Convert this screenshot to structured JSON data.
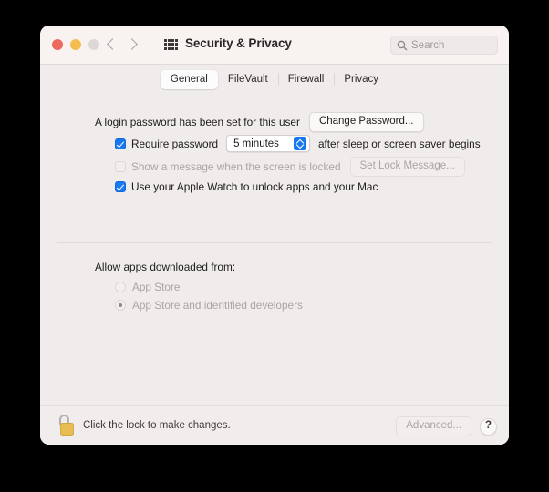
{
  "window": {
    "title": "Security & Privacy",
    "traffic_lights": [
      {
        "name": "close",
        "color": "#ec6a5e"
      },
      {
        "name": "minimize",
        "color": "#f4bd4f"
      },
      {
        "name": "zoom",
        "color": "#dcd8d8"
      }
    ],
    "nav": {
      "back_icon": "chevron-left-icon",
      "forward_icon": "chevron-right-icon"
    },
    "show_all_icon": "grid-icon",
    "search": {
      "placeholder": "Search",
      "value": "",
      "icon": "search-icon"
    }
  },
  "tabs": [
    {
      "label": "General",
      "selected": true
    },
    {
      "label": "FileVault",
      "selected": false
    },
    {
      "label": "Firewall",
      "selected": false
    },
    {
      "label": "Privacy",
      "selected": false
    }
  ],
  "general": {
    "password_status": "A login password has been set for this user",
    "change_password_button": "Change Password...",
    "require_password": {
      "checked": true,
      "label_before": "Require password",
      "interval_value": "5 minutes",
      "label_after": "after sleep or screen saver begins"
    },
    "screen_locked_message": {
      "checked": false,
      "disabled": true,
      "label": "Show a message when the screen is locked",
      "button": "Set Lock Message..."
    },
    "apple_watch": {
      "checked": true,
      "label": "Use your Apple Watch to unlock apps and your Mac"
    },
    "allow_apps": {
      "heading": "Allow apps downloaded from:",
      "disabled": true,
      "options": [
        {
          "label": "App Store",
          "selected": false
        },
        {
          "label": "App Store and identified developers",
          "selected": true
        }
      ]
    }
  },
  "footer": {
    "lock_icon": "unlocked-padlock-icon",
    "lock_message": "Click the lock to make changes.",
    "advanced_button": "Advanced...",
    "advanced_disabled": true,
    "help_button": "?"
  },
  "colors": {
    "accent": "#1878f0",
    "window_bg": "#f0ecec",
    "toolbar_bg": "#f8f2f1",
    "lock_gold": "#e7bd54",
    "desktop_bg": "#000000"
  }
}
